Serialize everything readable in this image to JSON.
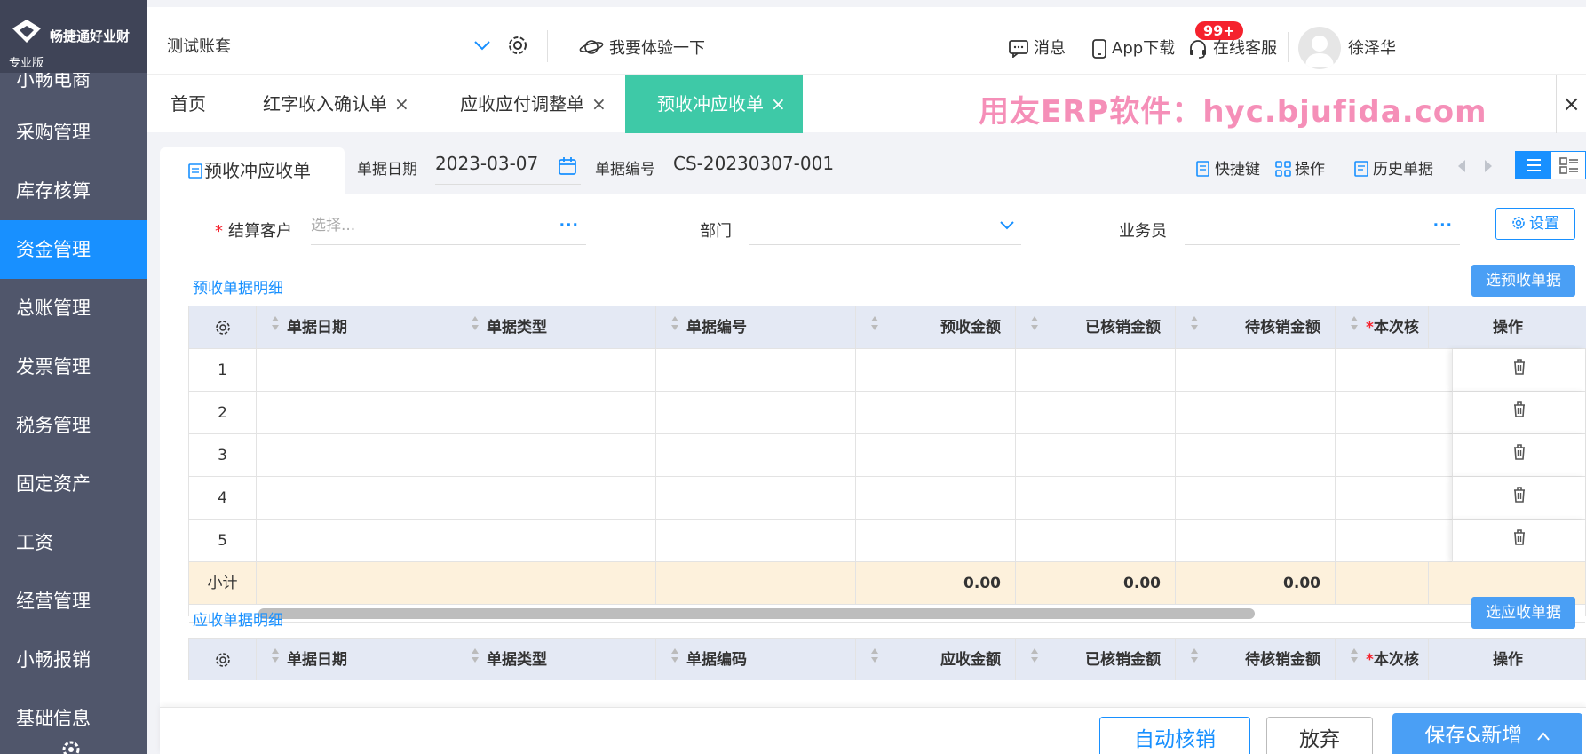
{
  "brand": {
    "name": "畅捷通好业财",
    "edition": "专业版"
  },
  "sidebar": {
    "items": [
      {
        "label": "小畅电商"
      },
      {
        "label": "采购管理"
      },
      {
        "label": "库存核算"
      },
      {
        "label": "资金管理",
        "active": true
      },
      {
        "label": "总账管理"
      },
      {
        "label": "发票管理"
      },
      {
        "label": "税务管理"
      },
      {
        "label": "固定资产"
      },
      {
        "label": "工资"
      },
      {
        "label": "经营管理"
      },
      {
        "label": "小畅报销"
      },
      {
        "label": "基础信息"
      }
    ]
  },
  "topbar": {
    "account": "测试账套",
    "try_label": "我要体验一下",
    "messages_label": "消息",
    "messages_badge": "99+",
    "app_label": "App下载",
    "service_label": "在线客服",
    "user_name": "徐泽华"
  },
  "tabs": [
    {
      "label": "首页",
      "closable": false
    },
    {
      "label": "红字收入确认单",
      "closable": true
    },
    {
      "label": "应收应付调整单",
      "closable": true
    },
    {
      "label": "预收冲应收单",
      "closable": true,
      "active": true
    }
  ],
  "tab_close_glyph": "×",
  "watermark": "用友ERP软件：hyc.bjufida.com",
  "doc": {
    "tab_label": "预收冲应收单",
    "date_label": "单据日期",
    "date_value": "2023-03-07",
    "number_label": "单据编号",
    "number_value": "CS-20230307-001",
    "tools": {
      "shortcut": "快捷键",
      "operate": "操作",
      "history": "历史单据"
    }
  },
  "form": {
    "customer_label": "结算客户",
    "customer_required": "*",
    "customer_placeholder": "选择...",
    "dept_label": "部门",
    "salesman_label": "业务员",
    "settings_label": "设置",
    "dots": "···"
  },
  "prepay_section": {
    "title": "预收单据明细",
    "select_button": "选预收单据",
    "columns": [
      "单据日期",
      "单据类型",
      "单据编号",
      "预收金额",
      "已核销金额",
      "待核销金额",
      "本次核"
    ],
    "op_column": "操作",
    "rows": [
      "1",
      "2",
      "3",
      "4",
      "5"
    ],
    "subtotal_label": "小计",
    "subtotals": [
      "0.00",
      "0.00",
      "0.00"
    ]
  },
  "receivable_section": {
    "title": "应收单据明细",
    "select_button": "选应收单据",
    "columns": [
      "单据日期",
      "单据类型",
      "单据编码",
      "应收金额",
      "已核销金额",
      "待核销金额",
      "本次核"
    ],
    "op_column": "操作"
  },
  "actions": {
    "auto_writeoff": "自动核销",
    "discard": "放弃",
    "save_new": "保存&新增"
  },
  "colors": {
    "sidebar": "#50566b",
    "active": "#1890ff",
    "tab_active": "#3ec9a7",
    "watermark": "#f58fb8",
    "subtotal_bg": "#fdf1dc"
  }
}
